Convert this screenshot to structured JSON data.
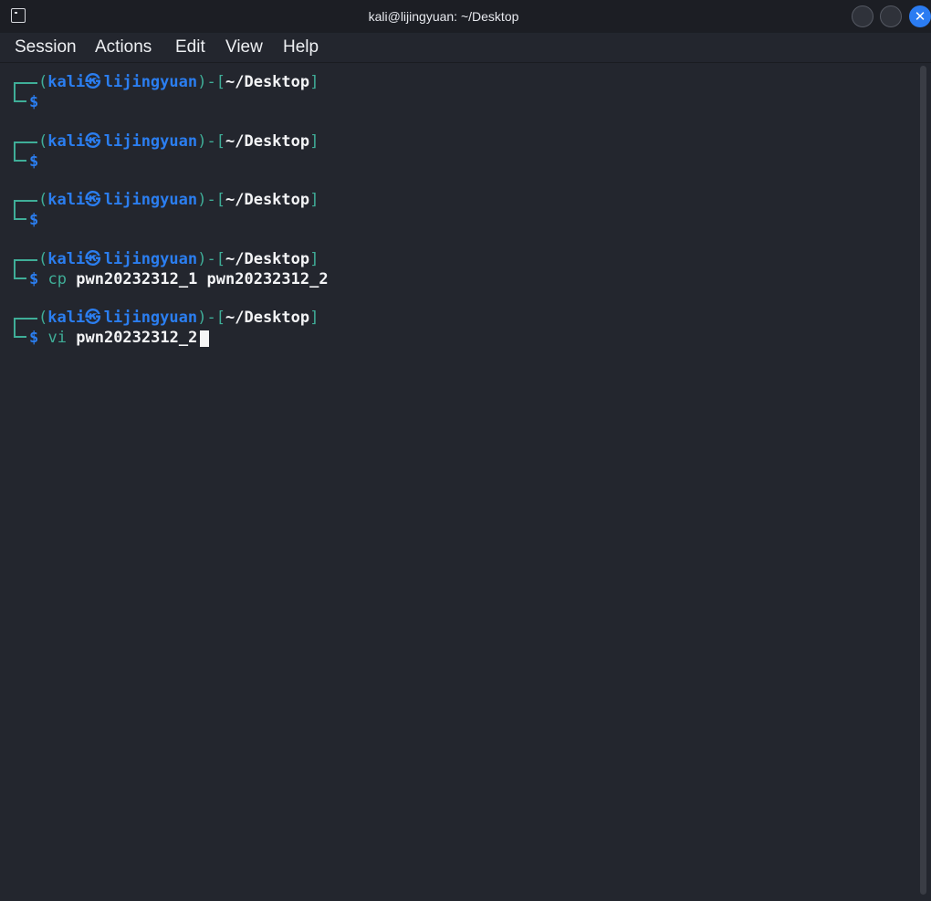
{
  "window": {
    "title": "kali@lijingyuan: ~/Desktop",
    "close_symbol": "✕"
  },
  "menu": {
    "items": [
      "Session",
      "Actions",
      "Edit",
      "View",
      "Help"
    ]
  },
  "terminal": {
    "prompt": {
      "open_paren": "(",
      "user": "kali",
      "at_symbol": "㉿",
      "host": "lijingyuan",
      "separator": ")-[",
      "path": "~/Desktop",
      "close_bracket": "]",
      "dollar": "$"
    },
    "blocks": [
      {
        "command": "",
        "args": ""
      },
      {
        "command": "",
        "args": ""
      },
      {
        "command": "",
        "args": ""
      },
      {
        "command": "cp",
        "args": "pwn20232312_1 pwn20232312_2"
      },
      {
        "command": "vi",
        "args": "pwn20232312_2"
      }
    ]
  },
  "colors": {
    "background": "#23262e",
    "titlebar": "#1c1e24",
    "teal": "#3fae98",
    "blue": "#2b7ef0",
    "close_button": "#2b7cf2"
  }
}
